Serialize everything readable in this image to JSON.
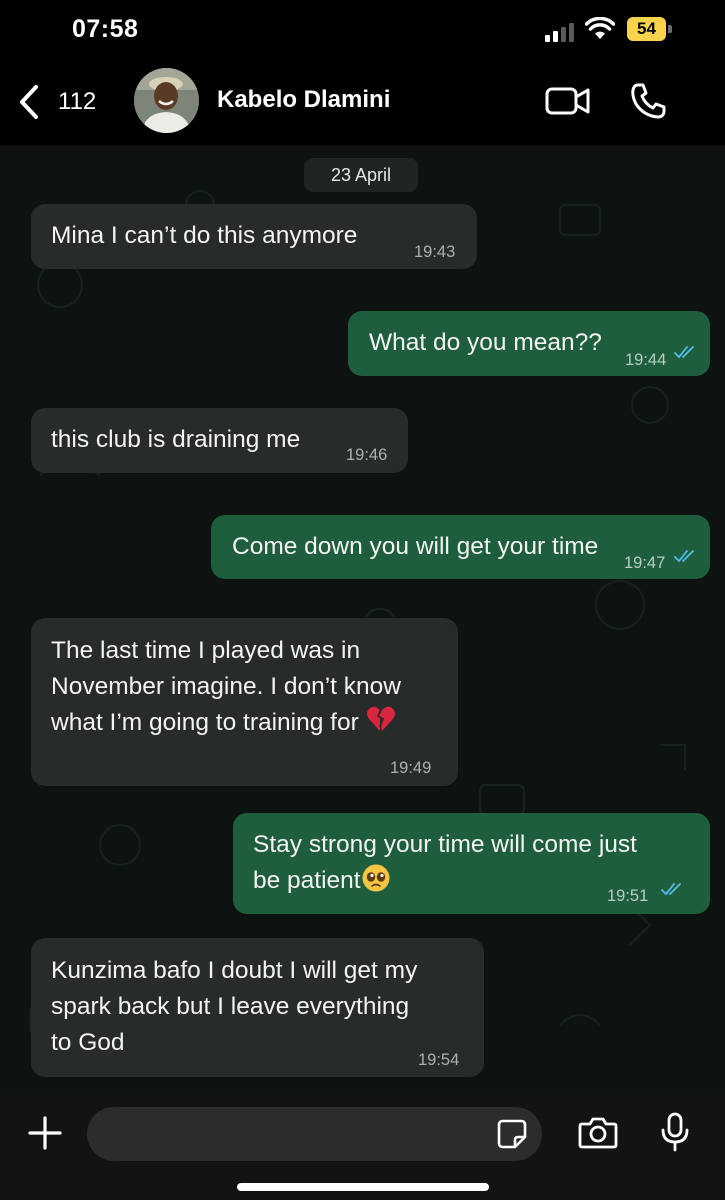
{
  "status_bar": {
    "time": "07:58",
    "battery": "54"
  },
  "header": {
    "back_count": "112",
    "contact_name": "Kabelo Dlamini"
  },
  "chat": {
    "date_chip": "23 April",
    "messages": [
      {
        "direction": "incoming",
        "lines": [
          "Mina I can’t do this anymore"
        ],
        "time": "19:43"
      },
      {
        "direction": "outgoing",
        "lines": [
          "What do you mean??"
        ],
        "time": "19:44",
        "status": "read"
      },
      {
        "direction": "incoming",
        "lines": [
          "this club is draining me"
        ],
        "time": "19:46"
      },
      {
        "direction": "outgoing",
        "lines": [
          "Come down you will get your time"
        ],
        "time": "19:47",
        "status": "read"
      },
      {
        "direction": "incoming",
        "lines": [
          "The last time I played was in",
          "November imagine. I don’t know",
          "what I’m going to training for"
        ],
        "trailing_emoji": "broken-heart",
        "time": "19:49"
      },
      {
        "direction": "outgoing",
        "lines": [
          "Stay strong your time will come just",
          "be patient"
        ],
        "trailing_emoji": "pleading-face",
        "time": "19:51",
        "status": "read"
      },
      {
        "direction": "incoming",
        "lines": [
          "Kunzima bafo I doubt I will get my",
          "spark back but I leave everything",
          "to God"
        ],
        "time": "19:54"
      }
    ]
  },
  "composer": {
    "input_value": ""
  },
  "colors": {
    "incoming_bubble": "#272b2a",
    "outgoing_bubble": "#1f5e3d",
    "read_ticks": "#53bdeb",
    "battery": "#f7d44b"
  }
}
